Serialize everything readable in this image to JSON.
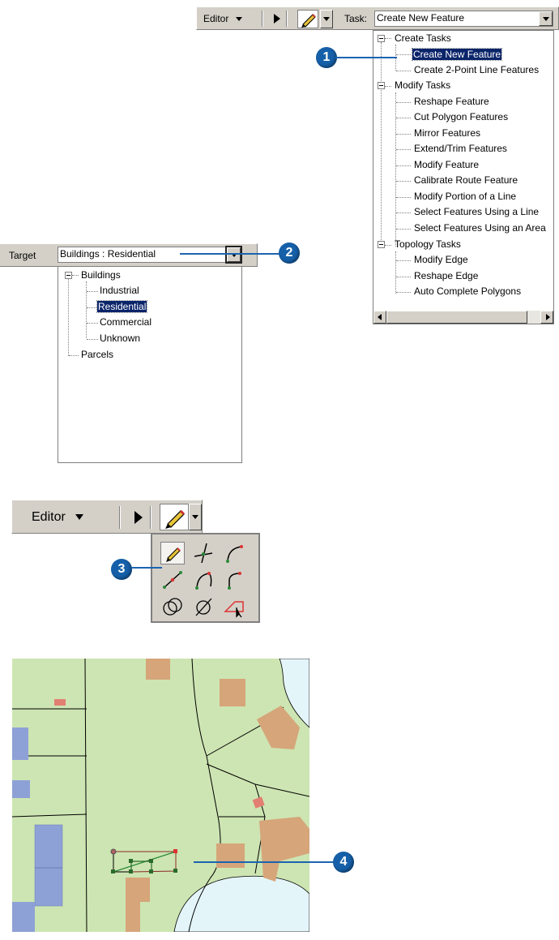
{
  "toolbar_top": {
    "editor_label": "Editor",
    "task_label": "Task:",
    "task_value": "Create New Feature"
  },
  "task_tree": {
    "groups": [
      {
        "label": "Create Tasks",
        "items": [
          "Create New Feature",
          "Create 2-Point Line Features"
        ]
      },
      {
        "label": "Modify Tasks",
        "items": [
          "Reshape Feature",
          "Cut Polygon Features",
          "Mirror Features",
          "Extend/Trim Features",
          "Modify Feature",
          "Calibrate Route Feature",
          "Modify Portion of a Line",
          "Select Features Using a Line",
          "Select Features Using an Area"
        ]
      },
      {
        "label": "Topology Tasks",
        "items": [
          "Modify Edge",
          "Reshape Edge",
          "Auto Complete Polygons"
        ]
      }
    ],
    "selected": "Create New Feature"
  },
  "target": {
    "label": "Target",
    "value": "Buildings : Residential",
    "tree": {
      "group": "Buildings",
      "items": [
        "Industrial",
        "Residential",
        "Commercial",
        "Unknown"
      ],
      "other": "Parcels",
      "selected": "Residential"
    }
  },
  "toolbar_bottom": {
    "editor_label": "Editor"
  },
  "callouts": [
    "1",
    "2",
    "3",
    "4"
  ],
  "colors": {
    "callout": "#1560a9",
    "selection": "#0a246a",
    "map_parcel": "#cde5b2",
    "map_building": "#d6a57a",
    "map_blue": "#8ea1d6",
    "map_water": "#e4f5fa"
  }
}
